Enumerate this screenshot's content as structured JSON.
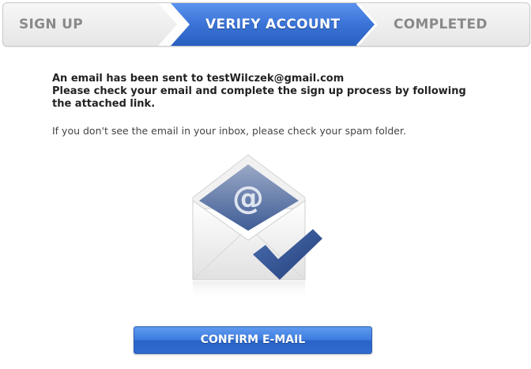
{
  "steps": [
    {
      "label": "SIGN UP",
      "state": "done"
    },
    {
      "label": "VERIFY ACCOUNT",
      "state": "active"
    },
    {
      "label": "COMPLETED",
      "state": "pending"
    }
  ],
  "message": {
    "line1": "An email has been sent to testWilczek@gmail.com",
    "line2": "Please check your email and complete the sign up process by following",
    "line3": "the attached link.",
    "note": "If you don't see the email in your inbox, please check your spam folder."
  },
  "illustration": {
    "icon": "envelope-at-checkmark-icon"
  },
  "confirm_button": {
    "label": "CONFIRM E-MAIL"
  },
  "colors": {
    "accent": "#3b78dc",
    "step_active": "#3a73d6",
    "check": "#2f4f8f"
  }
}
